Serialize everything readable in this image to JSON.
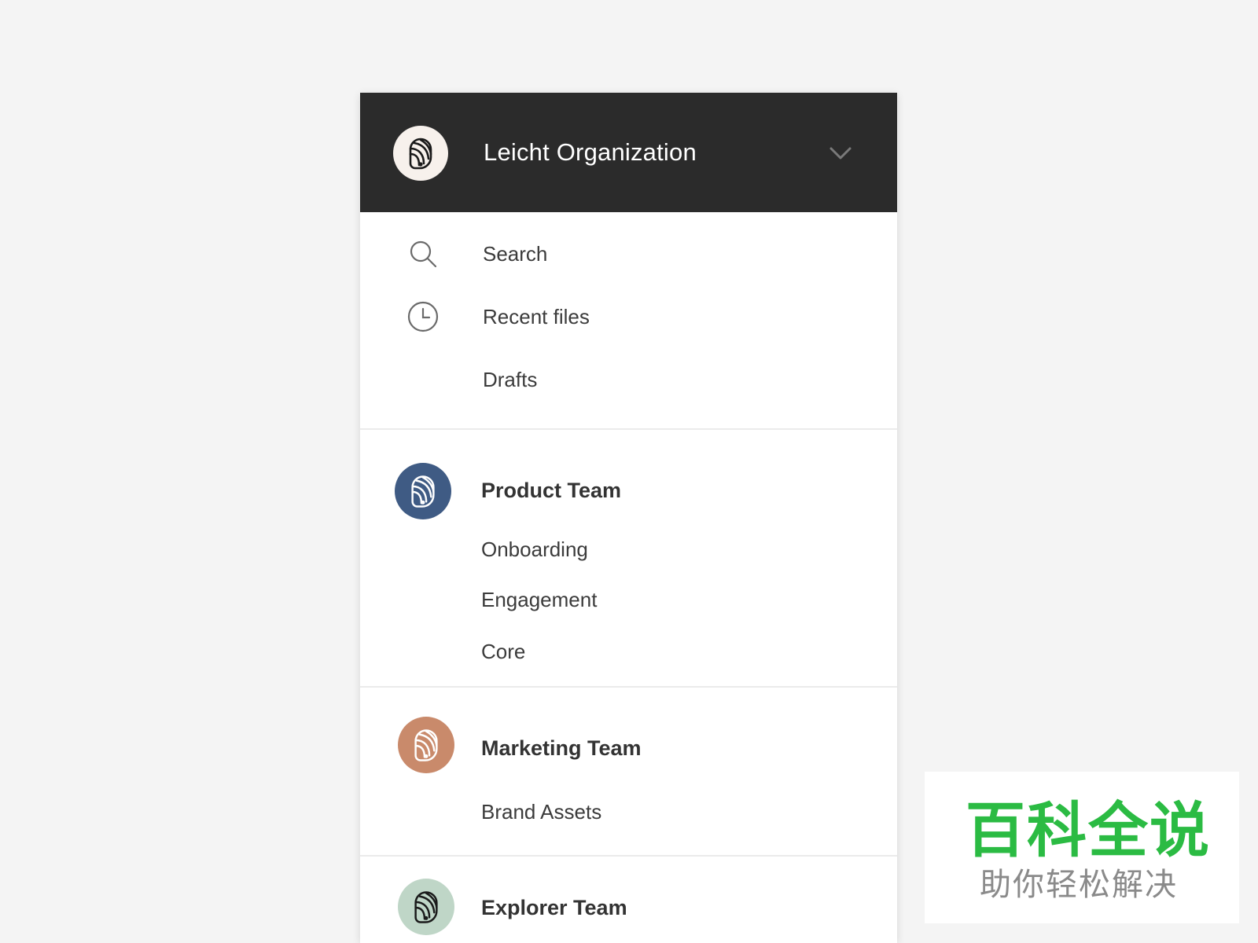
{
  "organization": {
    "name": "Leicht Organization",
    "logo_icon": "organization-logo-icon",
    "dropdown_icon": "chevron-down-icon",
    "header_color": "#2b2b2b"
  },
  "nav": {
    "items": [
      {
        "label": "Search",
        "icon": "search-icon"
      },
      {
        "label": "Recent files",
        "icon": "clock-icon"
      },
      {
        "label": "Drafts",
        "icon": ""
      }
    ]
  },
  "teams": [
    {
      "name": "Product Team",
      "avatar_color": "#3f5b84",
      "avatar_icon": "team-logo-icon",
      "projects": [
        "Onboarding",
        "Engagement",
        "Core"
      ]
    },
    {
      "name": "Marketing Team",
      "avatar_color": "#c98a6b",
      "avatar_icon": "team-logo-icon",
      "projects": [
        "Brand Assets"
      ]
    },
    {
      "name": "Explorer Team",
      "avatar_color": "#bfd6c7",
      "avatar_icon": "team-logo-icon",
      "projects": []
    }
  ],
  "watermark": {
    "main": "百科全说",
    "sub": "助你轻松解决"
  }
}
